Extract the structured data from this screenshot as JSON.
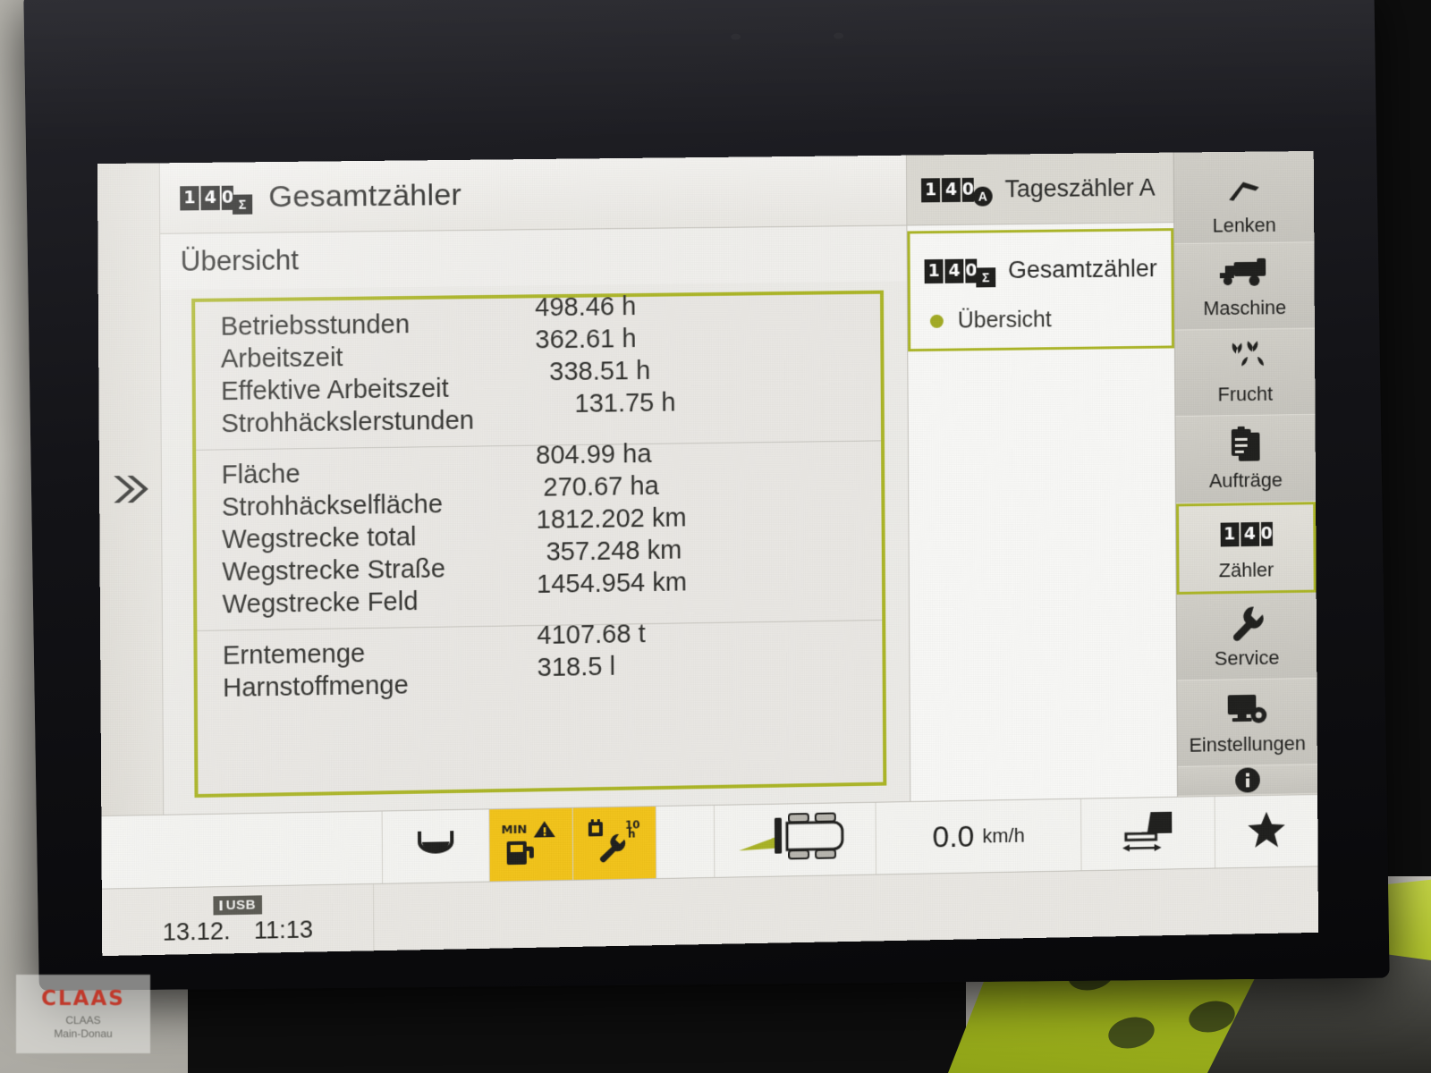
{
  "device": {
    "brand_watermark": "CLAAS",
    "dealer_line1": "CLAAS",
    "dealer_line2": "Main-Donau"
  },
  "header": {
    "title": "Gesamtzähler",
    "icon": "total-counter-odometer-icon",
    "odometer_digits": [
      "1",
      "4",
      "0"
    ],
    "odometer_badge": "Σ"
  },
  "subheader": {
    "title": "Übersicht"
  },
  "expand_rail": {
    "icon": "double-chevron-right-icon"
  },
  "counters_table": {
    "accent_color": "#adb726",
    "groups": [
      {
        "rows": [
          {
            "label": "Betriebsstunden",
            "value": "498.46 h"
          },
          {
            "label": "Arbeitszeit",
            "value": "362.61 h"
          },
          {
            "label": "Effektive Arbeitszeit",
            "value": "338.51 h"
          },
          {
            "label": "Strohhäckslerstunden",
            "value": "131.75 h"
          }
        ]
      },
      {
        "rows": [
          {
            "label": "Fläche",
            "value": "804.99 ha"
          },
          {
            "label": "Strohhäckselfläche",
            "value": "270.67 ha"
          },
          {
            "label": "Wegstrecke total",
            "value": "1812.202 km"
          },
          {
            "label": "Wegstrecke Straße",
            "value": "357.248 km"
          },
          {
            "label": "Wegstrecke Feld",
            "value": "1454.954 km"
          }
        ]
      },
      {
        "rows": [
          {
            "label": "Erntemenge",
            "value": "4107.68 t"
          },
          {
            "label": "Harnstoffmenge",
            "value": "318.5 l"
          }
        ]
      }
    ]
  },
  "counter_panel": {
    "day_counter": {
      "label": "Tageszähler A",
      "icon": "day-counter-odometer-icon",
      "digits": [
        "1",
        "4",
        "0"
      ],
      "badge": "A"
    },
    "total_counter": {
      "label": "Gesamtzähler",
      "icon": "total-counter-odometer-icon",
      "digits": [
        "1",
        "4",
        "0"
      ],
      "badge": "Σ",
      "selected": true
    },
    "sub_item": {
      "label": "Übersicht",
      "selected": true
    }
  },
  "sidebar": {
    "items": [
      {
        "label": "Lenken",
        "icon": "steering-auto-pilot-icon",
        "active": false
      },
      {
        "label": "Maschine",
        "icon": "combine-harvester-icon",
        "active": false
      },
      {
        "label": "Frucht",
        "icon": "wheat-ears-icon",
        "active": false
      },
      {
        "label": "Aufträge",
        "icon": "clipboard-tasks-icon",
        "active": false
      },
      {
        "label": "Zähler",
        "icon": "odometer-counter-icon",
        "active": true
      },
      {
        "label": "Service",
        "icon": "wrench-icon",
        "active": false
      },
      {
        "label": "Einstellungen",
        "icon": "monitor-gear-icon",
        "active": false
      }
    ],
    "partial_item": {
      "icon": "info-circle-icon"
    }
  },
  "statusbar": {
    "grain_tank_icon": "grain-tank-icon",
    "fuel_warning": {
      "icon": "fuel-pump-warning-icon",
      "label": "MIN",
      "color": "#f5c518"
    },
    "service_warning": {
      "icon": "service-wrench-hours-icon",
      "label": "10 h",
      "color": "#f5c518"
    },
    "machine_icon": "combine-top-view-icon",
    "speed_value": "0.0",
    "speed_unit": "km/h",
    "cutting_width_icon": "cutting-width-icon",
    "favorites_icon": "star-icon"
  },
  "footer": {
    "usb_label": "USB",
    "date": "13.12.",
    "time": "11:13"
  }
}
